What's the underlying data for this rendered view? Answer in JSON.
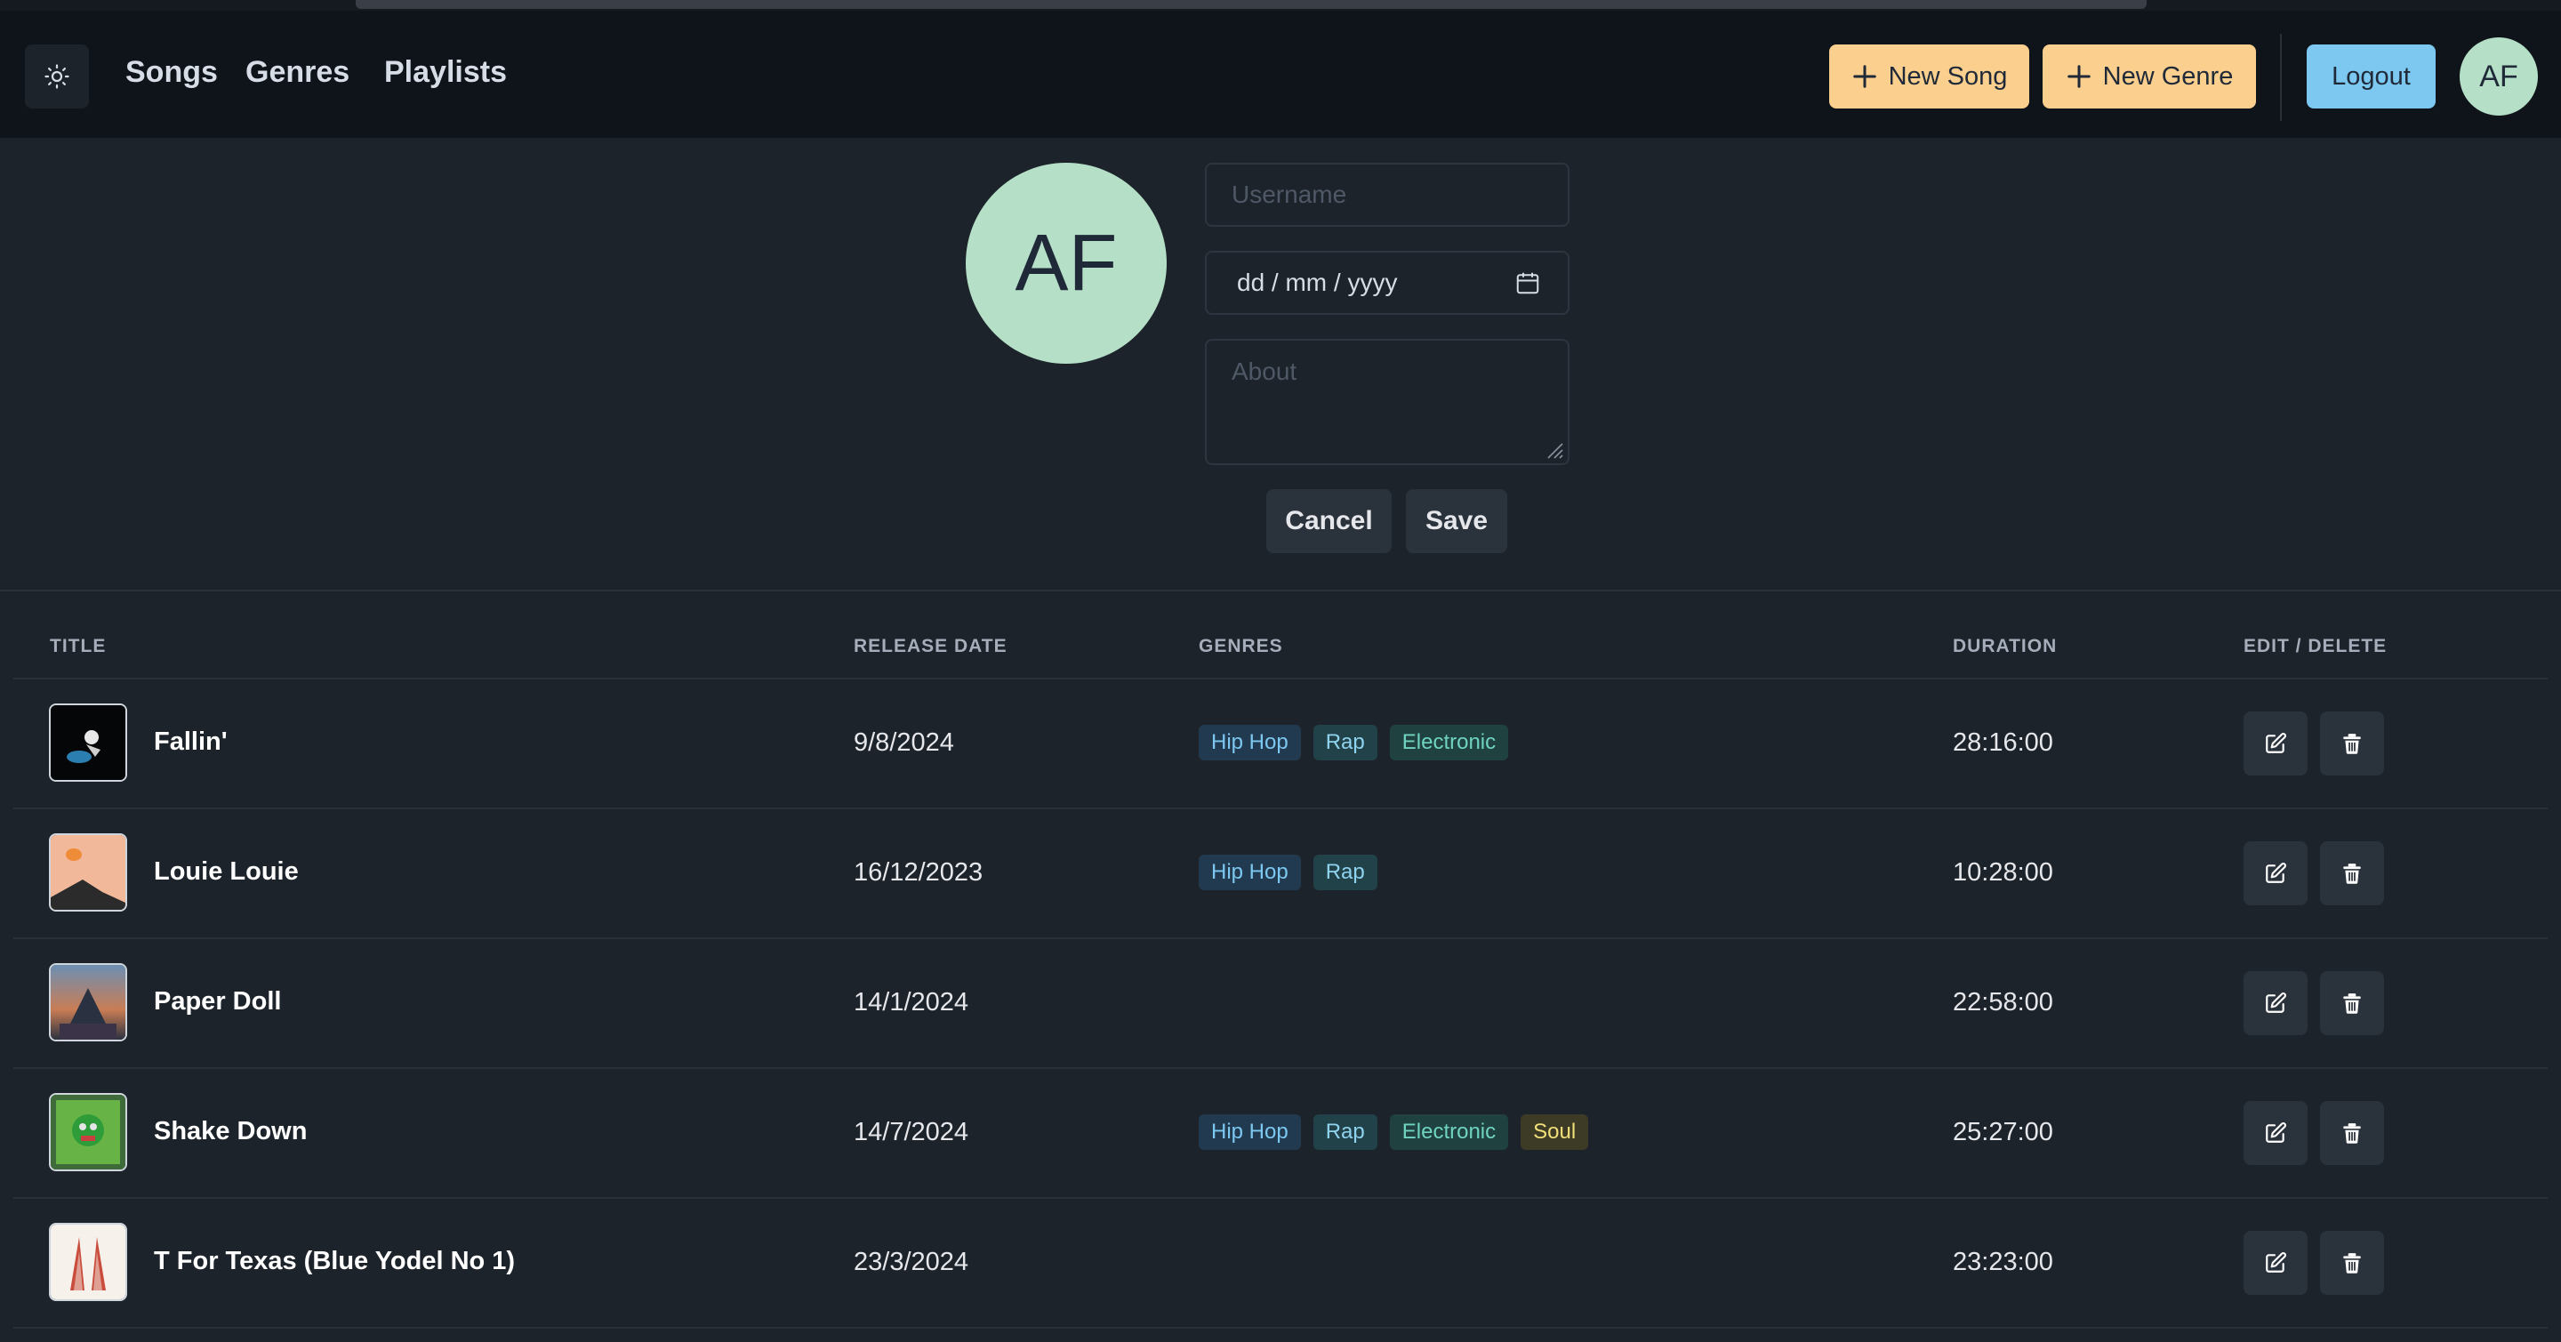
{
  "nav": {
    "links": [
      "Songs",
      "Genres",
      "Playlists"
    ],
    "new_song_label": "New Song",
    "new_genre_label": "New Genre",
    "logout_label": "Logout",
    "avatar_initials": "AF"
  },
  "profile_form": {
    "avatar_initials": "AF",
    "username_placeholder": "Username",
    "date_value": "dd / mm / yyyy",
    "about_placeholder": "About",
    "cancel_label": "Cancel",
    "save_label": "Save"
  },
  "table": {
    "headers": [
      "TITLE",
      "RELEASE DATE",
      "GENRES",
      "DURATION",
      "EDIT / DELETE"
    ],
    "rows": [
      {
        "title": "Fallin'",
        "release_date": "9/8/2024",
        "genres": [
          "Hip Hop",
          "Rap",
          "Electronic"
        ],
        "duration": "28:16:00"
      },
      {
        "title": "Louie Louie",
        "release_date": "16/12/2023",
        "genres": [
          "Hip Hop",
          "Rap"
        ],
        "duration": "10:28:00"
      },
      {
        "title": "Paper Doll",
        "release_date": "14/1/2024",
        "genres": [],
        "duration": "22:58:00"
      },
      {
        "title": "Shake Down",
        "release_date": "14/7/2024",
        "genres": [
          "Hip Hop",
          "Rap",
          "Electronic",
          "Soul"
        ],
        "duration": "25:27:00"
      },
      {
        "title": "T For Texas (Blue Yodel No 1)",
        "release_date": "23/3/2024",
        "genres": [],
        "duration": "23:23:00"
      }
    ]
  },
  "colors": {
    "background": "#1d232a",
    "navbar": "#0f141a",
    "warning": "#fbd08f",
    "info": "#7cc8f0",
    "avatar": "#b5dfc7",
    "genre_badges": {
      "Hip Hop": {
        "bg": "#223a4f",
        "fg": "#7cc8f0"
      },
      "Rap": {
        "bg": "#22424a",
        "fg": "#8fd3ee"
      },
      "Electronic": {
        "bg": "#1f4240",
        "fg": "#6fd3c0"
      },
      "Soul": {
        "bg": "#3d3b25",
        "fg": "#f2df7a"
      }
    }
  },
  "icons": {
    "theme": "sun-icon",
    "add": "plus-icon",
    "calendar": "calendar-icon",
    "edit": "edit-icon",
    "delete": "trash-icon"
  }
}
